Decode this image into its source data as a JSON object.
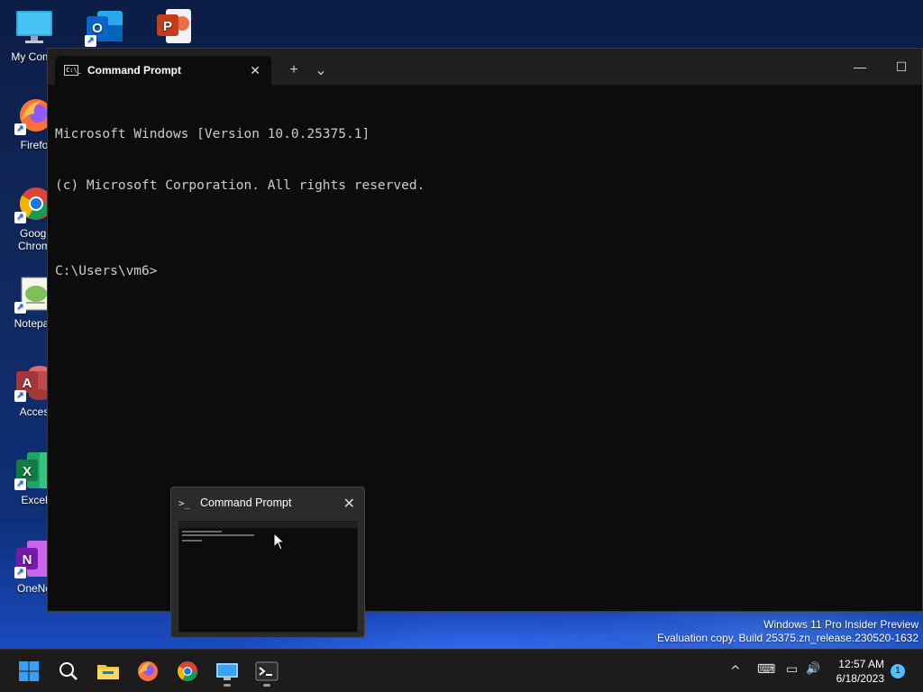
{
  "desktop": {
    "icons": [
      {
        "label": "My Comp",
        "glyph": "",
        "color": "#2fa7e6",
        "shortcut": false
      },
      {
        "label": "",
        "glyph": "O",
        "color": "#0a64c9",
        "shortcut": true
      },
      {
        "label": "",
        "glyph": "P",
        "color": "#c43e1c",
        "shortcut": false
      },
      {
        "label": "Firefo",
        "glyph": "",
        "color": "#ff7139",
        "shortcut": true
      },
      {
        "label": "Googl\nChrom",
        "glyph": "",
        "color": "#1a73e8",
        "shortcut": true
      },
      {
        "label": "Notepac",
        "glyph": "",
        "color": "#7fbf5a",
        "shortcut": true
      },
      {
        "label": "Acces",
        "glyph": "A",
        "color": "#a4373a",
        "shortcut": true
      },
      {
        "label": "Excel",
        "glyph": "X",
        "color": "#107c41",
        "shortcut": true
      },
      {
        "label": "OneNo",
        "glyph": "N",
        "color": "#7719aa",
        "shortcut": true
      }
    ]
  },
  "terminal": {
    "tab_title": "Command Prompt",
    "tab_icon_text": "C:\\_",
    "close_glyph": "✕",
    "new_tab_glyph": "+",
    "dropdown_glyph": "⌄",
    "minimize_glyph": "—",
    "maximize_glyph": "☐",
    "console_lines": [
      "Microsoft Windows [Version 10.0.25375.1]",
      "(c) Microsoft Corporation. All rights reserved.",
      "",
      "C:\\Users\\vm6>"
    ]
  },
  "thumbnail": {
    "title": "Command Prompt",
    "icon": ">_",
    "close_glyph": "✕"
  },
  "watermark": {
    "line1": "Windows 11 Pro Insider Preview",
    "line2": "Evaluation copy. Build 25375.zn_release.230520-1632"
  },
  "taskbar": {
    "apps": [
      "start-icon",
      "search-icon",
      "file-explorer-icon",
      "firefox-icon",
      "chrome-icon",
      "remote-desktop-icon",
      "terminal-icon"
    ],
    "tray": {
      "chevron": "^",
      "keyboard": "⌨",
      "network": "▭",
      "volume": "🔊"
    },
    "time": "12:57 AM",
    "date": "6/18/2023",
    "notification_count": "1"
  },
  "colors": {
    "console_bg": "#0c0c0c",
    "console_text": "#cccccc",
    "taskbar_bg": "#1c1c1c",
    "accent": "#4cc2ff"
  }
}
